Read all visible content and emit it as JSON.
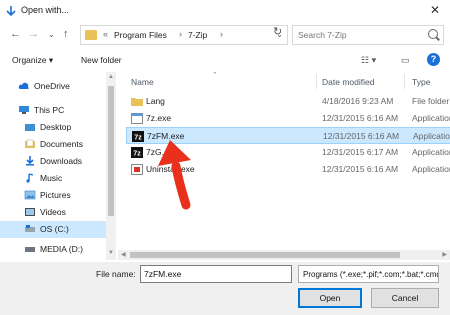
{
  "window": {
    "title": "Open with...",
    "close_glyph": "✕"
  },
  "nav_buttons": {
    "back": "←",
    "forward": "→",
    "dropdown": "⌄",
    "up": "↑",
    "refresh": "↻"
  },
  "address": {
    "overflow": "«",
    "crumbs": [
      "Program Files",
      "7-Zip"
    ],
    "separator": "›",
    "dropdown": "⌄"
  },
  "search": {
    "placeholder": "Search 7-Zip"
  },
  "toolbar": {
    "organize_label": "Organize ▾",
    "new_folder_label": "New folder",
    "view_glyph": "☷ ▾",
    "pane_glyph": "▭",
    "help_glyph": "?"
  },
  "sidebar": {
    "items": [
      {
        "label": "OneDrive",
        "icon": "cloud-icon"
      },
      {
        "label": "This PC",
        "icon": "computer-icon"
      },
      {
        "label": "Desktop",
        "icon": "desktop-folder-icon"
      },
      {
        "label": "Documents",
        "icon": "documents-folder-icon"
      },
      {
        "label": "Downloads",
        "icon": "downloads-folder-icon"
      },
      {
        "label": "Music",
        "icon": "music-folder-icon"
      },
      {
        "label": "Pictures",
        "icon": "pictures-folder-icon"
      },
      {
        "label": "Videos",
        "icon": "videos-folder-icon"
      },
      {
        "label": "OS (C:)",
        "icon": "drive-icon"
      },
      {
        "label": "MEDIA (D:)",
        "icon": "drive-icon"
      }
    ]
  },
  "columns": {
    "name": "Name",
    "date": "Date modified",
    "type": "Type"
  },
  "files": [
    {
      "name": "Lang",
      "date": "4/18/2016 9:23 AM",
      "type": "File folder",
      "icon": "folder-icon"
    },
    {
      "name": "7z.exe",
      "date": "12/31/2015 6:16 AM",
      "type": "Application",
      "icon": "app-icon"
    },
    {
      "name": "7zFM.exe",
      "date": "12/31/2015 6:16 AM",
      "type": "Application",
      "icon": "7zip-icon"
    },
    {
      "name": "7zG.exe",
      "date": "12/31/2015 6:17 AM",
      "type": "Application",
      "icon": "7zip-icon"
    },
    {
      "name": "Uninstall.exe",
      "date": "12/31/2015 6:16 AM",
      "type": "Application",
      "icon": "uninstall-icon"
    }
  ],
  "selected_file_index": 2,
  "bottom": {
    "file_name_label": "File name:",
    "file_name_value": "7zFM.exe",
    "file_type_value": "Programs (*.exe;*.pif;*.com;*.bat;*.cmd)",
    "open_label": "Open",
    "cancel_label": "Cancel"
  },
  "colors": {
    "accent": "#0078d7",
    "selection": "#cce8ff",
    "arrow": "#e8301c",
    "folder": "#e8c15a"
  }
}
